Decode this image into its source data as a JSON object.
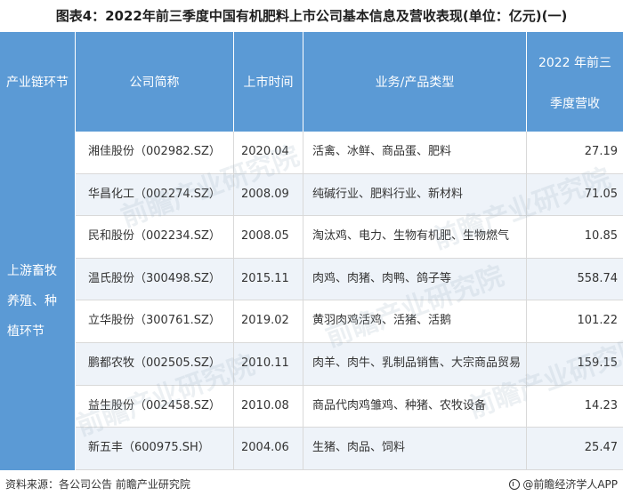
{
  "title": "图表4：2022年前三季度中国有机肥料上市公司基本信息及营收表现(单位：亿元)(一)",
  "headers": {
    "chain": "产业链环节",
    "company": "公司简称",
    "listing_time": "上市时间",
    "business": "业务/产品类型",
    "revenue_line1": "2022 年前三",
    "revenue_line2": "季度营收"
  },
  "group_label": "上游畜牧养殖、种植环节",
  "rows": [
    {
      "company": "湘佳股份（002982.SZ）",
      "date": "2020.04",
      "business": "活禽、冰鲜、商品蛋、肥料",
      "revenue": "27.19"
    },
    {
      "company": "华昌化工（002274.SZ）",
      "date": "2008.09",
      "business": "纯碱行业、肥料行业、新材料",
      "revenue": "71.05"
    },
    {
      "company": "民和股份（002234.SZ）",
      "date": "2008.05",
      "business": "淘汰鸡、电力、生物有机肥、生物燃气",
      "revenue": "10.85"
    },
    {
      "company": "温氏股份（300498.SZ）",
      "date": "2015.11",
      "business": "肉鸡、肉猪、肉鸭、鸽子等",
      "revenue": "558.74"
    },
    {
      "company": "立华股份（300761.SZ）",
      "date": "2019.02",
      "business": "黄羽肉鸡活鸡、活猪、活鹅",
      "revenue": "101.22"
    },
    {
      "company": "鹏都农牧（002505.SZ）",
      "date": "2010.11",
      "business": "肉羊、肉牛、乳制品销售、大宗商品贸易",
      "revenue": "159.15"
    },
    {
      "company": "益生股份（002458.SZ）",
      "date": "2010.08",
      "business": "商品代肉鸡雏鸡、种猪、农牧设备",
      "revenue": "14.23"
    },
    {
      "company": "新五丰（600975.SH）",
      "date": "2004.06",
      "business": "生猪、肉品、饲料",
      "revenue": "25.47"
    }
  ],
  "footer": {
    "source": "资料来源：各公司公告 前瞻产业研究院",
    "brand": "@前瞻经济学人APP"
  },
  "watermark_text": "前瞻产业研究院"
}
